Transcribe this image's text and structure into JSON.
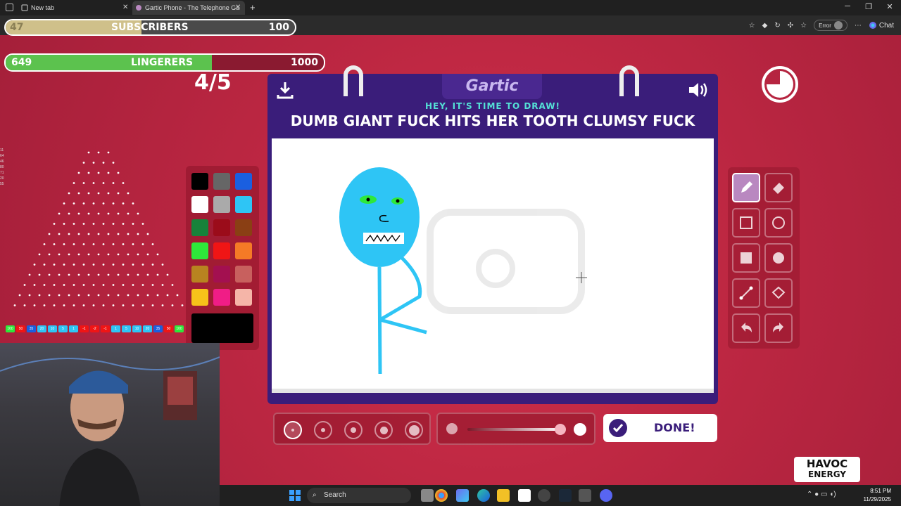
{
  "browser": {
    "tabs": [
      {
        "title": "New tab",
        "icon": "browser-tab-icon"
      },
      {
        "title": "Gartic Phone - The Telephone Ga",
        "icon": "gartic-phone-icon"
      }
    ],
    "new_tab_symbol": "+",
    "close_symbol": "✕",
    "error_label": "Error",
    "chat_label": "Chat"
  },
  "overlay": {
    "subscribers": {
      "current": "47",
      "label": "SUBSCRIBERS",
      "goal": "100",
      "progress": 0.47,
      "fill_color": "#cfc08a"
    },
    "lingerers": {
      "current": "649",
      "label": "LINGERERS",
      "goal": "1000",
      "progress": 0.649,
      "fill_color": "#5cc24e"
    },
    "sponsor_line1": "HAVOC",
    "sponsor_line2": "ENERGY"
  },
  "plinko": {
    "buckets": [
      "100",
      "50",
      "35",
      "20",
      "10",
      "5",
      "1",
      "-1",
      "-2",
      "-1",
      "1",
      "5",
      "10",
      "20",
      "35",
      "50",
      "100"
    ],
    "side_numbers": [
      "11",
      "64",
      "46",
      "80",
      "71",
      "20",
      "55"
    ]
  },
  "game": {
    "round": "4/5",
    "logo": "Gartic",
    "subtitle": "HEY, IT'S TIME TO DRAW!",
    "prompt": "DUMB GIANT FUCK HITS HER TOOTH CLUMSY FUCK",
    "done_label": "DONE!",
    "colors": [
      "#000000",
      "#666666",
      "#1a5fe0",
      "#ffffff",
      "#aaaaaa",
      "#2ec5f5",
      "#17823a",
      "#9b0c1a",
      "#8a3f14",
      "#2ee83a",
      "#f01515",
      "#f57a26",
      "#b88320",
      "#a31050",
      "#c8605e",
      "#f7c21a",
      "#f01d86",
      "#f5b5a8"
    ],
    "current_color": "#000000",
    "accent_color": "#3a1d7a"
  },
  "taskbar": {
    "search_placeholder": "Search",
    "time": "8:51 PM",
    "date": "11/29/2025"
  }
}
